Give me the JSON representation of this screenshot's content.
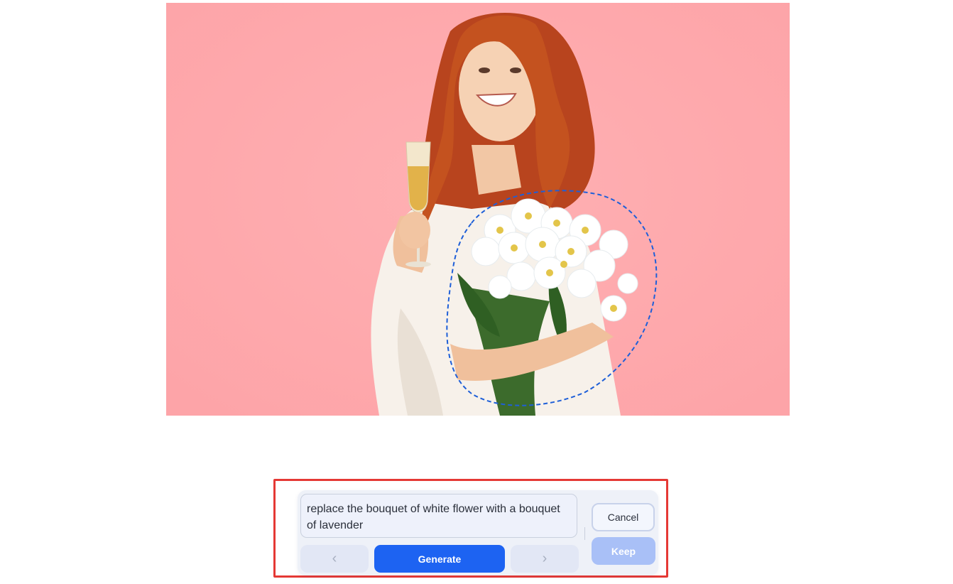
{
  "editor": {
    "prompt_text": "replace the bouquet of white flower with a bouquet of lavender",
    "prev_symbol": "‹",
    "next_symbol": "›",
    "generate_label": "Generate",
    "cancel_label": "Cancel",
    "keep_label": "Keep"
  },
  "icons": {
    "prev": "chevron-left-icon",
    "next": "chevron-right-icon"
  },
  "colors": {
    "background_pink": "#ffaaae",
    "selection_outline": "#1e5fd8",
    "primary_button": "#1d63f2",
    "keep_button_disabled": "#a9c0f7",
    "highlight_border": "#e53935"
  }
}
